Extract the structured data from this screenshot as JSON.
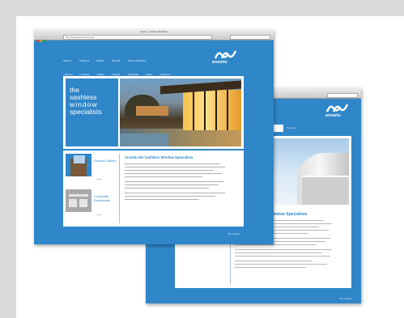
{
  "front_window": {
    "title": "Home - Anowtu Windows",
    "url": "http://www.anowtu.com.au/",
    "logo_text": "anowtu",
    "top_nav": [
      "About us",
      "Contact us",
      "Enquire",
      "Site map",
      "Terms & Conditions"
    ],
    "menu": [
      "About us",
      "Products",
      "Gallery",
      "Projects",
      "Downloads",
      "News",
      "Contact us"
    ],
    "hero_lines": [
      "the",
      "sashless",
      "window",
      "specialists"
    ],
    "cards": [
      {
        "label": "Product Gallery"
      },
      {
        "label": "Lunawhite Downloads"
      }
    ],
    "content_heading": "Anowtu the Sashless Window Specialists",
    "footer_text": "Site credits"
  },
  "back_window": {
    "title": "Projects - Anowtu Windows",
    "logo_text": "anowtu",
    "tab_label": "Projects",
    "content_heading": "Anowtu Sashless Window Specialists",
    "footer_text": "Site credits"
  },
  "colors": {
    "brand_blue": "#2f86c9",
    "frame_grey": "#d9d9d9"
  }
}
